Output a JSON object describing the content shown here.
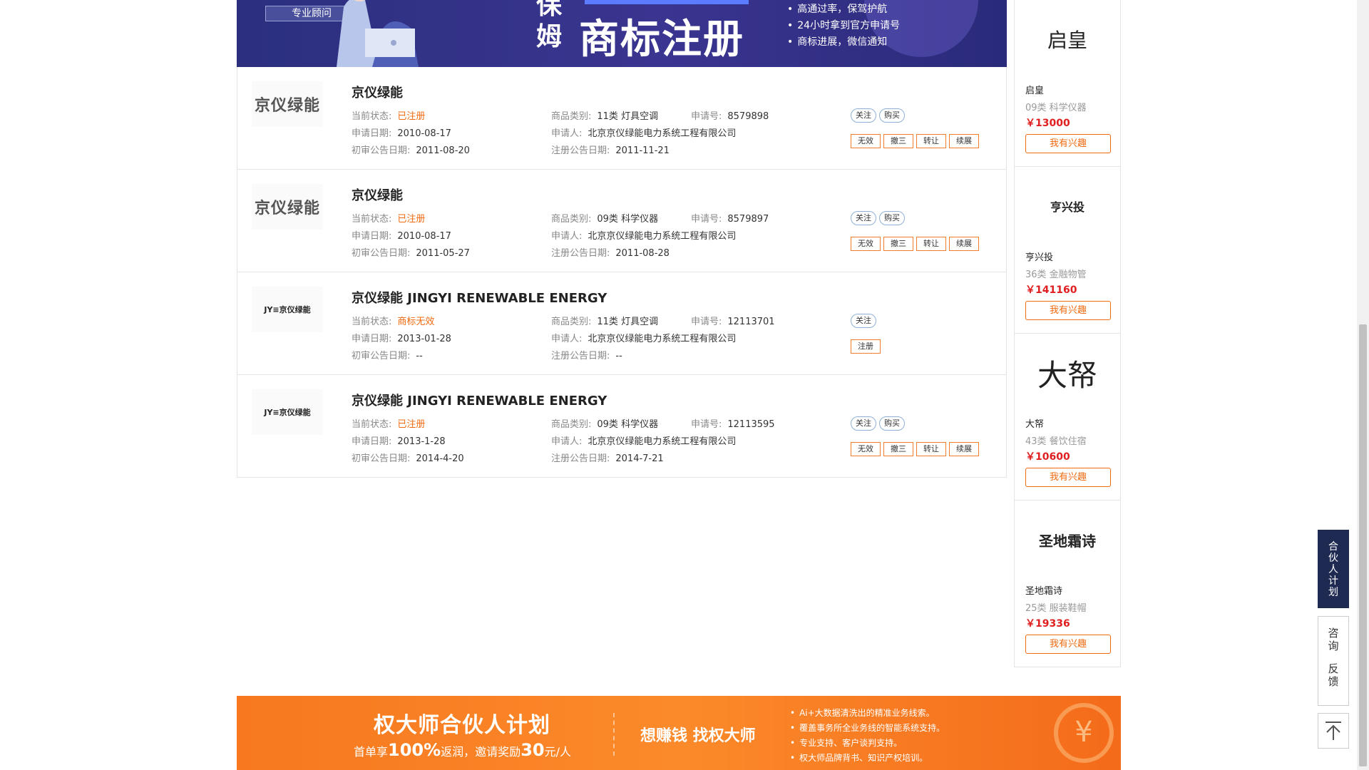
{
  "top_banner": {
    "consult_label": "专业顾问",
    "baomu": "保姆",
    "headline": "商标注册",
    "bullets": [
      "高通过率，保驾护航",
      "24小时拿到官方申请号",
      "商标进展，微信通知"
    ]
  },
  "labels": {
    "status": "当前状态:",
    "category": "商品类别:",
    "reg_no": "申请号:",
    "apply_date": "申请日期:",
    "applicant": "申请人:",
    "prelim_date": "初审公告日期:",
    "reg_date": "注册公告日期:"
  },
  "trademarks": [
    {
      "logo_text": "京仪绿能",
      "name": "京仪绿能",
      "status": "已注册",
      "category": "11类 灯具空调",
      "reg_no": "8579898",
      "apply_date": "2010-08-17",
      "applicant": "北京京仪绿能电力系统工程有限公司",
      "prelim_date": "2011-08-20",
      "reg_date": "2011-11-21",
      "pills": [
        "关注",
        "购买"
      ],
      "buttons": [
        "无效",
        "撤三",
        "转让",
        "续展"
      ]
    },
    {
      "logo_text": "京仪绿能",
      "name": "京仪绿能",
      "status": "已注册",
      "category": "09类 科学仪器",
      "reg_no": "8579897",
      "apply_date": "2010-08-17",
      "applicant": "北京京仪绿能电力系统工程有限公司",
      "prelim_date": "2011-05-27",
      "reg_date": "2011-08-28",
      "pills": [
        "关注",
        "购买"
      ],
      "buttons": [
        "无效",
        "撤三",
        "转让",
        "续展"
      ]
    },
    {
      "logo_text": "JY≡京仪绿能",
      "name": "京仪绿能 JINGYI RENEWABLE ENERGY",
      "status": "商标无效",
      "category": "11类 灯具空调",
      "reg_no": "12113701",
      "apply_date": "2013-01-28",
      "applicant": "北京京仪绿能电力系统工程有限公司",
      "prelim_date": "--",
      "reg_date": "--",
      "pills": [
        "关注"
      ],
      "buttons": [
        "注册"
      ]
    },
    {
      "logo_text": "JY≡京仪绿能",
      "name": "京仪绿能 JINGYI RENEWABLE ENERGY",
      "status": "已注册",
      "category": "09类 科学仪器",
      "reg_no": "12113595",
      "apply_date": "2013-1-28",
      "applicant": "北京京仪绿能电力系统工程有限公司",
      "prelim_date": "2014-4-20",
      "reg_date": "2014-7-21",
      "pills": [
        "关注",
        "购买"
      ],
      "buttons": [
        "无效",
        "撤三",
        "转让",
        "续展"
      ]
    }
  ],
  "side_cards": [
    {
      "logo": "启皇",
      "name": "启皇",
      "category": "09类 科学仪器",
      "price": "￥13000",
      "button": "我有兴趣"
    },
    {
      "logo": "亨兴投",
      "name": "亨兴投",
      "category": "36类 金融物管",
      "price": "￥141160",
      "button": "我有兴趣"
    },
    {
      "logo": "大帑",
      "name": "大帑",
      "category": "43类 餐饮住宿",
      "price": "￥10600",
      "button": "我有兴趣"
    },
    {
      "logo": "圣地霜诗",
      "name": "圣地霜诗",
      "category": "25类 服装鞋帽",
      "price": "￥19336",
      "button": "我有兴趣"
    }
  ],
  "bottom_banner": {
    "title": "权大师合伙人计划",
    "sub_pre": "首单享",
    "sub_pct": "100%",
    "sub_mid": "返润，邀请奖励",
    "sub_amt": "30",
    "sub_unit": "元/人",
    "slogan": "想赚钱  找权大师",
    "points": [
      "Ai+大数据清洗出的精准业务线索。",
      "覆盖事务所全业务线的智能系统支持。",
      "专业支持、客户谈判支持。",
      "权大师品牌背书、知识产权培训。"
    ],
    "coin": "¥"
  },
  "float_tools": {
    "partner_chars": [
      "合",
      "伙",
      "人",
      "计",
      "划"
    ],
    "consult_chars": [
      "咨",
      "询"
    ],
    "feedback_chars": [
      "反",
      "馈"
    ]
  }
}
